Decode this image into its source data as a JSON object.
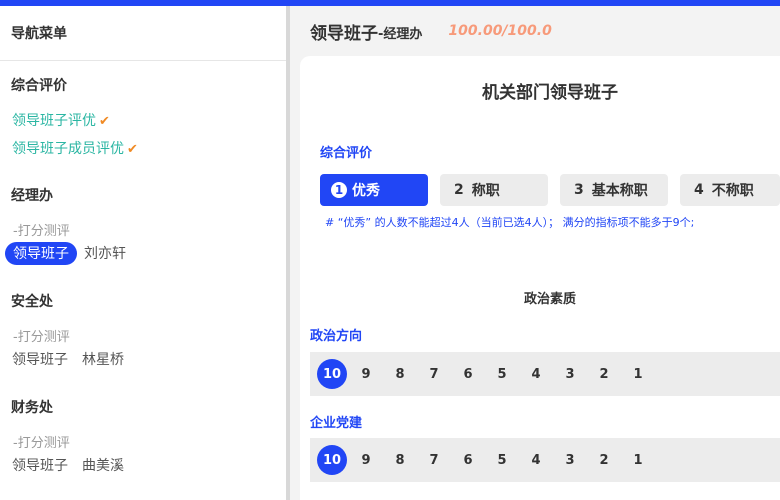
{
  "sidebar": {
    "header": "导航菜单",
    "sections": [
      {
        "title": "综合评价",
        "links": [
          "领导班子评优",
          "领导班子成员评优"
        ],
        "check": "✔"
      },
      {
        "title": "经理办",
        "sub": "-打分测评",
        "tag": "领导班子",
        "member": "刘亦轩",
        "active": true
      },
      {
        "title": "安全处",
        "sub": "-打分测评",
        "tag": "领导班子",
        "member": "林星桥",
        "active": false
      },
      {
        "title": "财务处",
        "sub": "-打分测评",
        "tag": "领导班子",
        "member": "曲美溪",
        "active": false
      }
    ]
  },
  "header": {
    "title": "领导班子",
    "subtitle": "-经理办",
    "score": "100.00/100.0"
  },
  "card": {
    "title": "机关部门领导班子",
    "section_label": "综合评价",
    "grades": [
      {
        "num": "1",
        "label": "优秀",
        "active": true
      },
      {
        "num": "2",
        "label": "称职",
        "active": false
      },
      {
        "num": "3",
        "label": "基本称职",
        "active": false
      },
      {
        "num": "4",
        "label": "不称职",
        "active": false
      }
    ],
    "note": "# “优秀” 的人数不能超过4人（当前已选4人）；  满分的指标项不能多于9个;",
    "group_title": "政治素质",
    "items": [
      {
        "label": "政治方向",
        "selected": "10"
      },
      {
        "label": "企业党建",
        "selected": "10"
      }
    ],
    "scores": [
      "10",
      "9",
      "8",
      "7",
      "6",
      "5",
      "4",
      "3",
      "2",
      "1"
    ]
  },
  "colors": {
    "accent": "#2146f5",
    "check": "#f08a24",
    "link": "#2bb6a3",
    "score": "#f79a7a"
  }
}
